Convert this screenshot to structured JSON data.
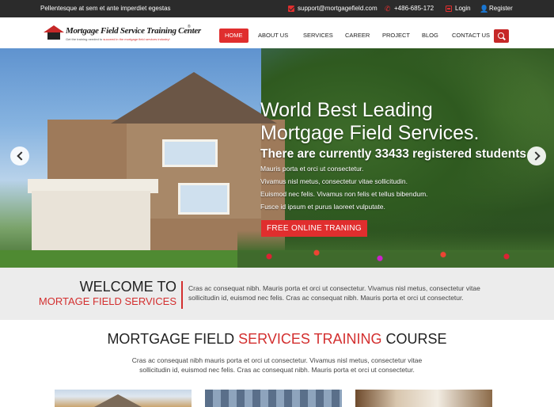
{
  "topbar": {
    "tagline": "Pellentesque at sem et ante imperdiet egestas",
    "email": "support@mortgagefield.com",
    "phone": "+486-685-172",
    "login": "Login",
    "register": "Register",
    "icons": [
      "mail-icon",
      "phone-icon",
      "login-icon",
      "user-icon"
    ]
  },
  "logo": {
    "name": "Mortgage Field Service Training Center",
    "reg": "®",
    "sub_prefix": "Get the training needed to",
    "sub_highlight": "succeed in the mortgage field services industry!"
  },
  "nav": {
    "items": [
      "HOME",
      "ABOUT US",
      "SERVICES",
      "CAREER",
      "PROJECT",
      "BLOG",
      "CONTACT US"
    ],
    "active_index": 0
  },
  "hero": {
    "headline_line1": "World Best  Leading",
    "headline_line2": "Mortgage Field Services.",
    "subheadline": "There are currently 33433 registered students",
    "lines": [
      "Mauris porta et orci ut consectetur.",
      "Vivamus nisl metus, consectetur vitae sollicitudin.",
      "Euismod nec felis. Vivamus non felis et tellus bibendum.",
      "Fusce id ipsum et purus laoreet vulputate."
    ],
    "cta": "FREE ONLINE TRANING"
  },
  "welcome": {
    "line1": "WELCOME TO",
    "line2": "MORTAGE FIELD SERVICES",
    "text": "Cras ac consequat nibh. Mauris porta et orci ut consectetur. Vivamus nisl metus, consectetur vitae sollicitudin id, euismod nec felis.  Cras ac consequat nibh. Mauris porta et orci ut consectetur."
  },
  "course": {
    "title_part1": "MORTGAGE FIELD ",
    "title_red": "SERVICES TRAINING",
    "title_part2": " COURSE",
    "desc": "Cras ac consequat nibh mauris porta et orci ut consectetur. Vivamus nisl metus, consectetur vitae sollicitudin id, euismod nec felis.  Cras ac consequat nibh. Mauris porta et orci ut consectetur."
  },
  "colors": {
    "accent": "#e02e2e",
    "topbar_bg": "#2b2b2b",
    "welcome_bg": "#ececec"
  }
}
